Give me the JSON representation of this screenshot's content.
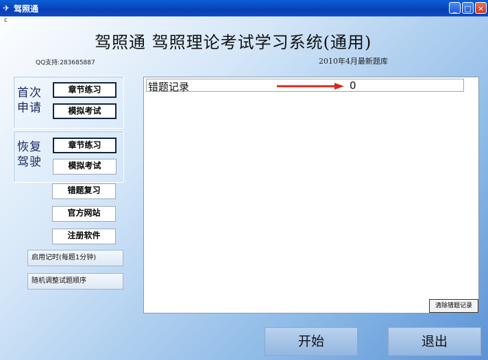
{
  "window": {
    "title": "驾照通",
    "icon": "car-icon",
    "controls": {
      "minimize": "_",
      "maximize": "□",
      "close": "×"
    }
  },
  "corner_char": "c",
  "header": {
    "title": "驾照通 驾照理论考试学习系统(通用)",
    "qq_support": "QQ支持:283685887",
    "version": "2010年4月最新题库"
  },
  "groups": [
    {
      "label": "首次申请",
      "buttons": [
        "章节练习",
        "模拟考试"
      ]
    },
    {
      "label": "恢复驾驶",
      "buttons": [
        "章节练习",
        "模拟考试"
      ]
    }
  ],
  "extra_buttons": [
    "错题复习",
    "官方网站",
    "注册软件"
  ],
  "options": [
    "启用记时(每题1分钟)",
    "随机调整试题顺序"
  ],
  "panel": {
    "error_label": "错题记录",
    "error_count": "0",
    "clear_button": "清除错题记录"
  },
  "footer": {
    "start": "开始",
    "exit": "退出"
  },
  "colors": {
    "title_bar": "#0a4fc8",
    "arrow": "#d42a1a",
    "close_btn": "#d0472a"
  }
}
